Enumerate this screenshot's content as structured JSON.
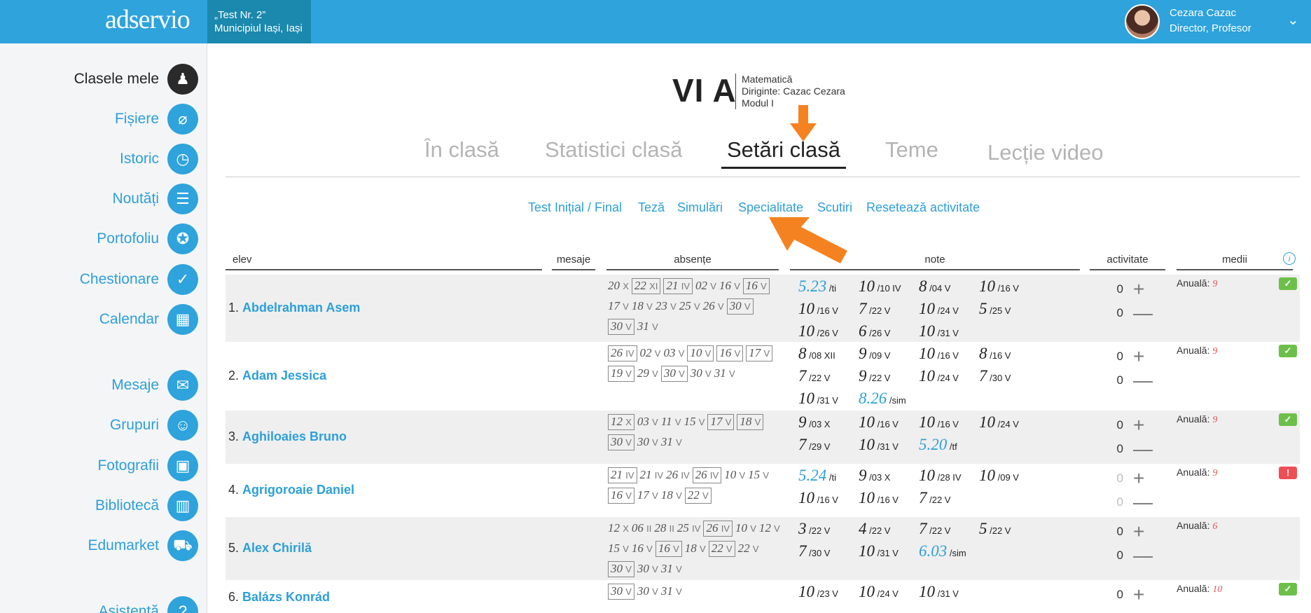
{
  "header": {
    "logo": "adservio",
    "school_line1": "„Test Nr. 2”",
    "school_line2": "Municipiul Iași, Iași",
    "user_name": "Cezara Cazac",
    "user_role": "Director, Profesor"
  },
  "sidebar": {
    "items": [
      {
        "label": "Clasele mele",
        "icon": "classroom-icon",
        "glyph": "♟"
      },
      {
        "label": "Fișiere",
        "icon": "paperclip-icon",
        "glyph": "⌀"
      },
      {
        "label": "Istoric",
        "icon": "history-icon",
        "glyph": "◷"
      },
      {
        "label": "Noutăți",
        "icon": "news-icon",
        "glyph": "☰"
      },
      {
        "label": "Portofoliu",
        "icon": "portfolio-icon",
        "glyph": "✪"
      },
      {
        "label": "Chestionare",
        "icon": "questionnaire-icon",
        "glyph": "✓"
      },
      {
        "label": "Calendar",
        "icon": "calendar-icon",
        "glyph": "▦"
      },
      {
        "label": "Mesaje",
        "icon": "mail-icon",
        "glyph": "✉"
      },
      {
        "label": "Grupuri",
        "icon": "groups-icon",
        "glyph": "☺"
      },
      {
        "label": "Fotografii",
        "icon": "photos-icon",
        "glyph": "▣"
      },
      {
        "label": "Bibliotecă",
        "icon": "library-icon",
        "glyph": "▥"
      },
      {
        "label": "Edumarket",
        "icon": "cart-icon",
        "glyph": "⛟"
      },
      {
        "label": "Asistență",
        "icon": "help-icon",
        "glyph": "?"
      }
    ]
  },
  "class": {
    "name": "VI A",
    "subject": "Matematică",
    "teacher": "Diriginte: Cazac Cezara",
    "module": "Modul I"
  },
  "tabs": [
    "În clasă",
    "Statistici clasă",
    "Setări clasă",
    "Teme",
    "Lecție video"
  ],
  "subnav": [
    "Test Inițial / Final",
    "Teză",
    "Simulări",
    "Specialitate",
    "Scutiri",
    "Resetează activitate"
  ],
  "table": {
    "headers": {
      "elev": "elev",
      "mesaje": "mesaje",
      "absente": "absențe",
      "note": "note",
      "activitate": "activitate",
      "medii": "medii"
    },
    "rows": [
      {
        "index": "1.",
        "name": "Abdelrahman Asem",
        "absences": [
          [
            "20",
            "X",
            false
          ],
          [
            "22",
            "XI",
            true
          ],
          [
            "21",
            "IV",
            true
          ],
          [
            "02",
            "V",
            false
          ],
          [
            "16",
            "V",
            false
          ],
          [
            "16",
            "V",
            true
          ],
          [
            "17",
            "V",
            false
          ],
          [
            "18",
            "V",
            false
          ],
          [
            "23",
            "V",
            false
          ],
          [
            "25",
            "V",
            false
          ],
          [
            "26",
            "V",
            false
          ],
          [
            "30",
            "V",
            true
          ],
          [
            "30",
            "V",
            true
          ],
          [
            "31",
            "V",
            false
          ]
        ],
        "grades": [
          [
            "5.23",
            "/ti",
            true
          ],
          [
            "10",
            "/10 IV",
            false
          ],
          [
            "8",
            "/04 V",
            false
          ],
          [
            "10",
            "/16 V",
            false
          ],
          [
            "10",
            "/16 V",
            false
          ],
          [
            "7",
            "/22 V",
            false
          ],
          [
            "10",
            "/24 V",
            false
          ],
          [
            "5",
            "/25 V",
            false
          ],
          [
            "10",
            "/26 V",
            false
          ],
          [
            "6",
            "/26 V",
            false
          ],
          [
            "10",
            "/31 V",
            false
          ]
        ],
        "act_plus": "0",
        "act_minus": "0",
        "act_grey": false,
        "annual_label": "Anuală:",
        "annual": "9",
        "status": "ok"
      },
      {
        "index": "2.",
        "name": "Adam Jessica",
        "absences": [
          [
            "26",
            "IV",
            true
          ],
          [
            "02",
            "V",
            false
          ],
          [
            "03",
            "V",
            false
          ],
          [
            "10",
            "V",
            true
          ],
          [
            "16",
            "V",
            true
          ],
          [
            "17",
            "V",
            true
          ],
          [
            "19",
            "V",
            true
          ],
          [
            "29",
            "V",
            false
          ],
          [
            "30",
            "V",
            true
          ],
          [
            "30",
            "V",
            false
          ],
          [
            "31",
            "V",
            false
          ]
        ],
        "grades": [
          [
            "8",
            "/08 XII",
            false
          ],
          [
            "9",
            "/09 V",
            false
          ],
          [
            "10",
            "/16 V",
            false
          ],
          [
            "8",
            "/16 V",
            false
          ],
          [
            "7",
            "/22 V",
            false
          ],
          [
            "9",
            "/22 V",
            false
          ],
          [
            "10",
            "/24 V",
            false
          ],
          [
            "7",
            "/30 V",
            false
          ],
          [
            "10",
            "/31 V",
            false
          ],
          [
            "8.26",
            "/sim",
            true
          ]
        ],
        "act_plus": "0",
        "act_minus": "0",
        "act_grey": false,
        "annual_label": "Anuală:",
        "annual": "9",
        "status": "ok"
      },
      {
        "index": "3.",
        "name": "Aghiloaies Bruno",
        "absences": [
          [
            "12",
            "X",
            true
          ],
          [
            "03",
            "V",
            false
          ],
          [
            "11",
            "V",
            false
          ],
          [
            "15",
            "V",
            false
          ],
          [
            "17",
            "V",
            true
          ],
          [
            "18",
            "V",
            true
          ],
          [
            "30",
            "V",
            true
          ],
          [
            "30",
            "V",
            false
          ],
          [
            "31",
            "V",
            false
          ]
        ],
        "grades": [
          [
            "9",
            "/03 X",
            false
          ],
          [
            "10",
            "/16 V",
            false
          ],
          [
            "10",
            "/16 V",
            false
          ],
          [
            "10",
            "/24 V",
            false
          ],
          [
            "7",
            "/29 V",
            false
          ],
          [
            "10",
            "/31 V",
            false
          ],
          [
            "5.20",
            "/tf",
            true
          ]
        ],
        "act_plus": "0",
        "act_minus": "0",
        "act_grey": false,
        "annual_label": "Anuală:",
        "annual": "9",
        "status": "ok"
      },
      {
        "index": "4.",
        "name": "Agrigoroaie Daniel",
        "absences": [
          [
            "21",
            "IV",
            true
          ],
          [
            "21",
            "IV",
            false
          ],
          [
            "26",
            "IV",
            false
          ],
          [
            "26",
            "IV",
            true
          ],
          [
            "10",
            "V",
            false
          ],
          [
            "15",
            "V",
            false
          ],
          [
            "16",
            "V",
            true
          ],
          [
            "17",
            "V",
            false
          ],
          [
            "18",
            "V",
            false
          ],
          [
            "22",
            "V",
            true
          ]
        ],
        "grades": [
          [
            "5.24",
            "/ti",
            true
          ],
          [
            "9",
            "/03 X",
            false
          ],
          [
            "10",
            "/28 IV",
            false
          ],
          [
            "10",
            "/09 V",
            false
          ],
          [
            "10",
            "/16 V",
            false
          ],
          [
            "10",
            "/16 V",
            false
          ],
          [
            "7",
            "/22 V",
            false
          ]
        ],
        "act_plus": "0",
        "act_minus": "0",
        "act_grey": true,
        "annual_label": "Anuală:",
        "annual": "9",
        "status": "warn"
      },
      {
        "index": "5.",
        "name": "Alex Chirilă",
        "absences": [
          [
            "12",
            "X",
            false
          ],
          [
            "06",
            "II",
            false
          ],
          [
            "28",
            "II",
            false
          ],
          [
            "25",
            "IV",
            false
          ],
          [
            "26",
            "IV",
            true
          ],
          [
            "10",
            "V",
            false
          ],
          [
            "12",
            "V",
            false
          ],
          [
            "15",
            "V",
            false
          ],
          [
            "16",
            "V",
            false
          ],
          [
            "16",
            "V",
            true
          ],
          [
            "18",
            "V",
            false
          ],
          [
            "22",
            "V",
            true
          ],
          [
            "22",
            "V",
            false
          ],
          [
            "30",
            "V",
            true
          ],
          [
            "30",
            "V",
            false
          ],
          [
            "31",
            "V",
            false
          ]
        ],
        "grades": [
          [
            "3",
            "/22 V",
            false
          ],
          [
            "4",
            "/22 V",
            false
          ],
          [
            "7",
            "/22 V",
            false
          ],
          [
            "5",
            "/22 V",
            false
          ],
          [
            "7",
            "/30 V",
            false
          ],
          [
            "10",
            "/31 V",
            false
          ],
          [
            "6.03",
            "/sim",
            true
          ]
        ],
        "act_plus": "0",
        "act_minus": "0",
        "act_grey": false,
        "annual_label": "Anuală:",
        "annual": "6",
        "status": "none"
      },
      {
        "index": "6.",
        "name": "Balázs Konrád",
        "absences": [
          [
            "30",
            "V",
            true
          ],
          [
            "30",
            "V",
            false
          ],
          [
            "31",
            "V",
            false
          ]
        ],
        "grades": [
          [
            "10",
            "/23 V",
            false
          ],
          [
            "10",
            "/24 V",
            false
          ],
          [
            "10",
            "/31 V",
            false
          ]
        ],
        "act_plus": "0",
        "act_minus": "",
        "act_grey": false,
        "annual_label": "Anuală:",
        "annual": "10",
        "status": "ok"
      }
    ]
  },
  "colors": {
    "brand": "#2ea3dc",
    "brand_dark": "#1b88ae",
    "annotation_arrow": "#f58220",
    "ok": "#6cc04a",
    "warn": "#ee4f55"
  }
}
